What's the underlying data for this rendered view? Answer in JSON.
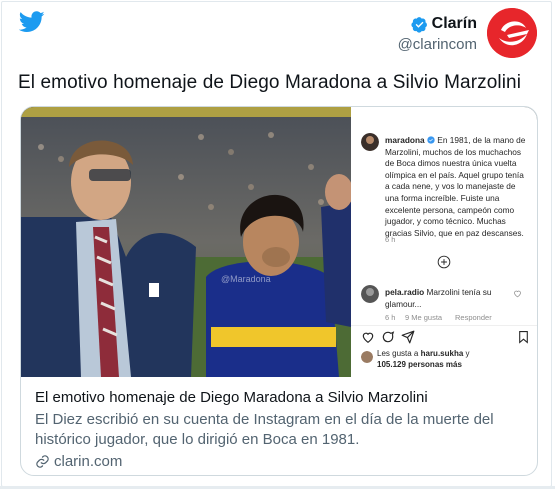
{
  "tweet": {
    "author_name": "Clarín",
    "author_handle": "@clarincom",
    "headline": "El emotivo homenaje de Diego Maradona a Silvio Marzolini"
  },
  "card": {
    "title": "El emotivo homenaje de Diego Maradona a Silvio Marzolini",
    "description": "El Diez escribió en su cuenta de Instagram en el día de la muerte del histórico jugador, que lo dirigió en Boca en 1981.",
    "domain": "clarin.com"
  },
  "instagram": {
    "username": "maradona",
    "caption": "En 1981, de la mano de Marzolini, muchos de los muchachos de Boca dimos nuestra única vuelta olímpica en el país. Aquel grupo tenía a cada nene, y vos lo manejaste de una forma increíble. Fuiste una excelente persona, campeón como jugador, y como técnico. Muchas gracias Silvio, que en paz descanses.",
    "caption_time": "6 h",
    "comment_user": "pela.radio",
    "comment_text": "Marzolini tenía su glamour...",
    "comment_time": "6 h",
    "comment_likes": "9 Me gusta",
    "comment_reply": "Responder",
    "likes_prefix": "Les gusta a",
    "likes_user": "haru.sukha",
    "likes_conj": "y",
    "likes_count": "105.129 personas más",
    "watermark": "@Maradona"
  },
  "colors": {
    "twitter_blue": "#1d9bf0",
    "clarin_red": "#e7262b",
    "secondary_text": "#536471"
  },
  "icons": [
    "twitter-bird-icon",
    "verified-badge-icon",
    "link-icon",
    "heart-icon",
    "comment-icon",
    "share-icon",
    "bookmark-icon",
    "add-icon"
  ]
}
